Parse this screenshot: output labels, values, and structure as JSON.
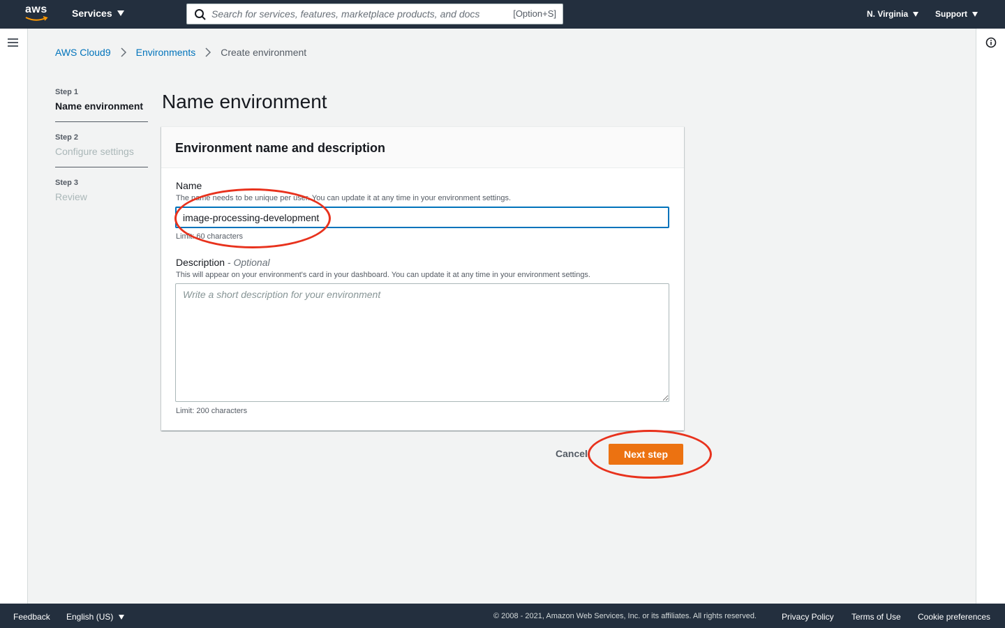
{
  "topnav": {
    "logo_text": "aws",
    "services_label": "Services",
    "search_placeholder": "Search for services, features, marketplace products, and docs",
    "search_shortcut": "[Option+S]",
    "region_label": "N. Virginia",
    "support_label": "Support"
  },
  "breadcrumb": {
    "items": [
      "AWS Cloud9",
      "Environments"
    ],
    "current": "Create environment"
  },
  "steps": [
    {
      "number": "Step 1",
      "title": "Name environment",
      "active": true
    },
    {
      "number": "Step 2",
      "title": "Configure settings",
      "active": false
    },
    {
      "number": "Step 3",
      "title": "Review",
      "active": false
    }
  ],
  "main": {
    "title": "Name environment",
    "panel_title": "Environment name and description",
    "name": {
      "label": "Name",
      "description": "The name needs to be unique per user. You can update it at any time in your environment settings.",
      "value": "image-processing-development",
      "limit": "Limit: 60 characters"
    },
    "description": {
      "label": "Description",
      "optional": "- Optional",
      "description": "This will appear on your environment's card in your dashboard. You can update it at any time in your environment settings.",
      "placeholder": "Write a short description for your environment",
      "limit": "Limit: 200 characters"
    },
    "cancel_label": "Cancel",
    "next_label": "Next step"
  },
  "footer": {
    "feedback": "Feedback",
    "language": "English (US)",
    "copyright": "© 2008 - 2021, Amazon Web Services, Inc. or its affiliates. All rights reserved.",
    "privacy": "Privacy Policy",
    "terms": "Terms of Use",
    "cookies": "Cookie preferences"
  },
  "colors": {
    "nav_bg": "#232f3e",
    "link": "#0073bb",
    "primary_button": "#ec7211",
    "annotation": "#e8321d"
  }
}
